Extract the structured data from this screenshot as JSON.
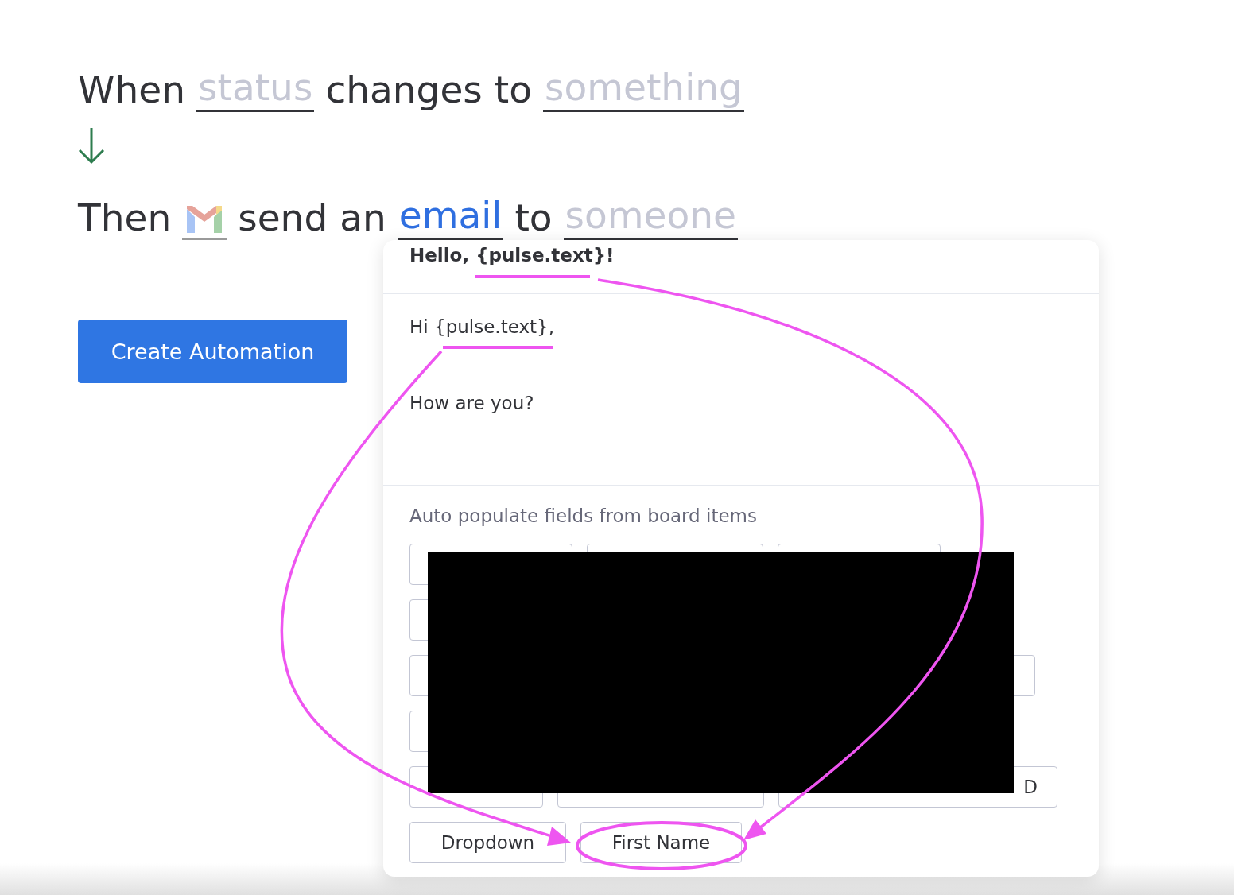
{
  "trigger": {
    "parts": [
      {
        "kind": "text",
        "text": "When"
      },
      {
        "kind": "placeholder",
        "text": "status"
      },
      {
        "kind": "text",
        "text": "changes to"
      },
      {
        "kind": "placeholder",
        "text": "something"
      }
    ]
  },
  "action": {
    "parts": [
      {
        "kind": "text",
        "text": "Then"
      },
      {
        "kind": "gmail_icon"
      },
      {
        "kind": "text",
        "text": "send an"
      },
      {
        "kind": "chosen",
        "text": "email"
      },
      {
        "kind": "text",
        "text": "to"
      },
      {
        "kind": "placeholder",
        "text": "someone"
      }
    ]
  },
  "create_button": {
    "label": "Create Automation"
  },
  "email": {
    "subject": "Hello, {pulse.text}!",
    "body_lines": [
      "Hi {pulse.text},",
      "How are you?"
    ],
    "fields_label": "Auto populate fields from board items",
    "chip_rows": [
      [
        {
          "kind": "covered"
        },
        {
          "kind": "covered"
        },
        {
          "kind": "covered"
        }
      ],
      [
        {
          "kind": "covered"
        }
      ],
      [
        {
          "kind": "covered"
        },
        {
          "kind": "covered"
        }
      ],
      [
        {
          "kind": "covered"
        }
      ],
      [
        {
          "kind": "covered"
        },
        {
          "kind": "covered"
        },
        {
          "kind": "partial",
          "label": "D"
        }
      ],
      [
        {
          "kind": "label",
          "label": "Dropdown"
        },
        {
          "kind": "label",
          "label": "First Name"
        }
      ]
    ]
  }
}
